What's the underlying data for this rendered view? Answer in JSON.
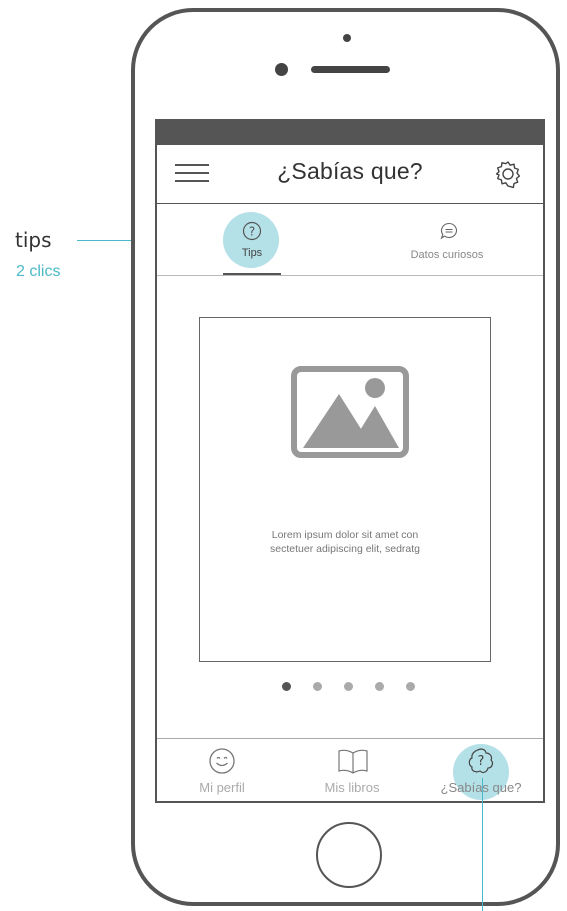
{
  "header": {
    "title": "¿Sabías que?"
  },
  "tabs": [
    {
      "label": "Tips",
      "active": true
    },
    {
      "label": "Datos curiosos",
      "active": false
    }
  ],
  "card": {
    "text_line1": "Lorem ipsum dolor sit amet con",
    "text_line2": "sectetuer adipiscing elit, sedratg"
  },
  "carousel": {
    "pages": 5,
    "active_index": 0
  },
  "bottom_nav": [
    {
      "label": "Mi perfil",
      "icon": "smiley-icon"
    },
    {
      "label": "Mis libros",
      "icon": "open-book-icon"
    },
    {
      "label": "¿Sabías que?",
      "icon": "question-bubble-icon",
      "highlighted": true
    }
  ],
  "annotations": {
    "tips_label": "tips",
    "clicks_label": "2 clics"
  },
  "colors": {
    "highlight": "#b4e0e7",
    "annotation": "#4bb9c9",
    "frame": "#555555"
  }
}
